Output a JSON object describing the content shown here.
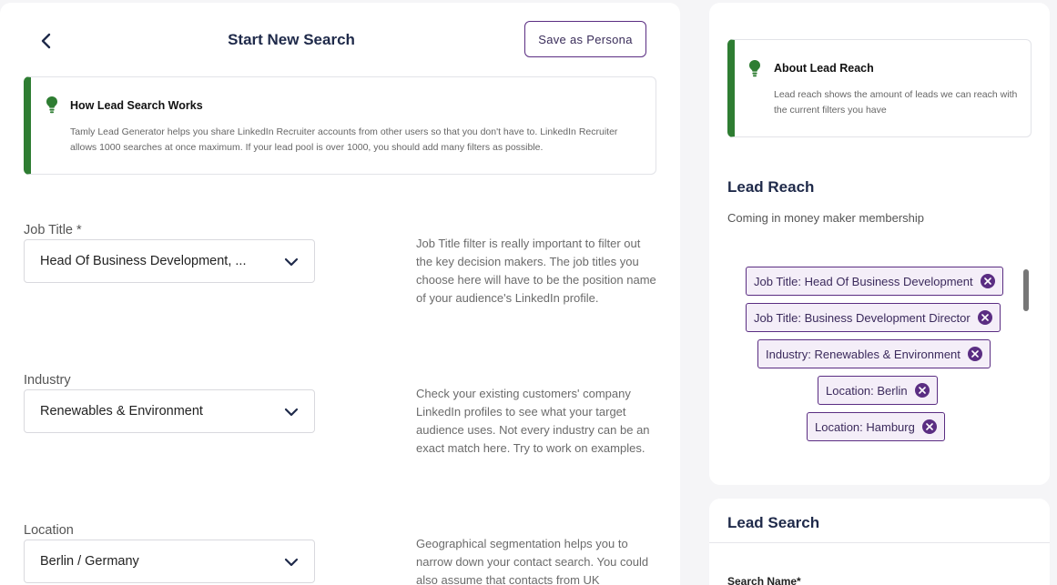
{
  "header": {
    "title": "Start New Search",
    "save_label": "Save as Persona"
  },
  "how_it_works": {
    "title": "How Lead Search Works",
    "text": "Tamly Lead Generator helps you share LinkedIn Recruiter accounts from other users so that you don't have to. LinkedIn Recruiter allows 1000 searches at once maximum. If your lead pool is over 1000, you should add many filters as possible."
  },
  "fields": [
    {
      "label": "Job Title *",
      "value": "Head Of Business Development, ...",
      "help": "Job Title filter is really important to filter out the key decision makers. The job titles you choose here will have to be the position name of your audience's LinkedIn profile."
    },
    {
      "label": "Industry",
      "value": "Renewables & Environment",
      "help": "Check your existing customers' company LinkedIn profiles to see what your target audience uses. Not every industry can be an exact match here. Try to work on examples."
    },
    {
      "label": "Location",
      "value": "Berlin / Germany",
      "help": "Geographical segmentation helps you to narrow down your contact search. You could also assume that contacts from UK"
    }
  ],
  "about_reach": {
    "title": "About Lead Reach",
    "text": "Lead reach shows the amount of leads we can reach with the current filters you have"
  },
  "lead_reach": {
    "title": "Lead Reach",
    "subtitle": "Coming in money maker membership"
  },
  "chips": [
    "Job Title: Head Of Business Development",
    "Job Title: Business Development Director",
    "Industry: Renewables & Environment",
    "Location: Berlin",
    "Location: Hamburg"
  ],
  "lead_search": {
    "title": "Lead Search",
    "search_name_label": "Search Name*"
  },
  "colors": {
    "accent_green": "#2e7d32",
    "accent_purple": "#5a2d82",
    "chip_bg": "#f4eef8"
  },
  "icons": [
    "chevron-left-icon",
    "lightbulb-icon",
    "chevron-down-icon",
    "close-circle-icon"
  ]
}
